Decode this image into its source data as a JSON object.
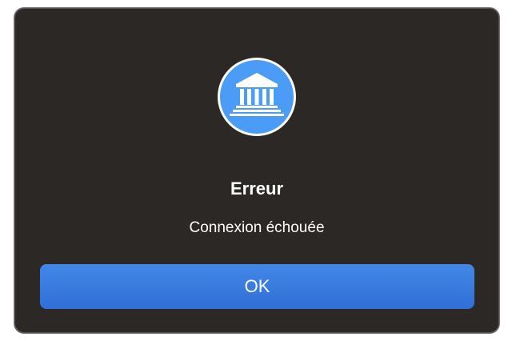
{
  "dialog": {
    "icon": "bank-building-icon",
    "title": "Erreur",
    "message": "Connexion échouée",
    "ok_label": "OK"
  },
  "colors": {
    "background": "#2c2826",
    "accent": "#3a7be0",
    "icon_fill": "#4a9cf7"
  }
}
